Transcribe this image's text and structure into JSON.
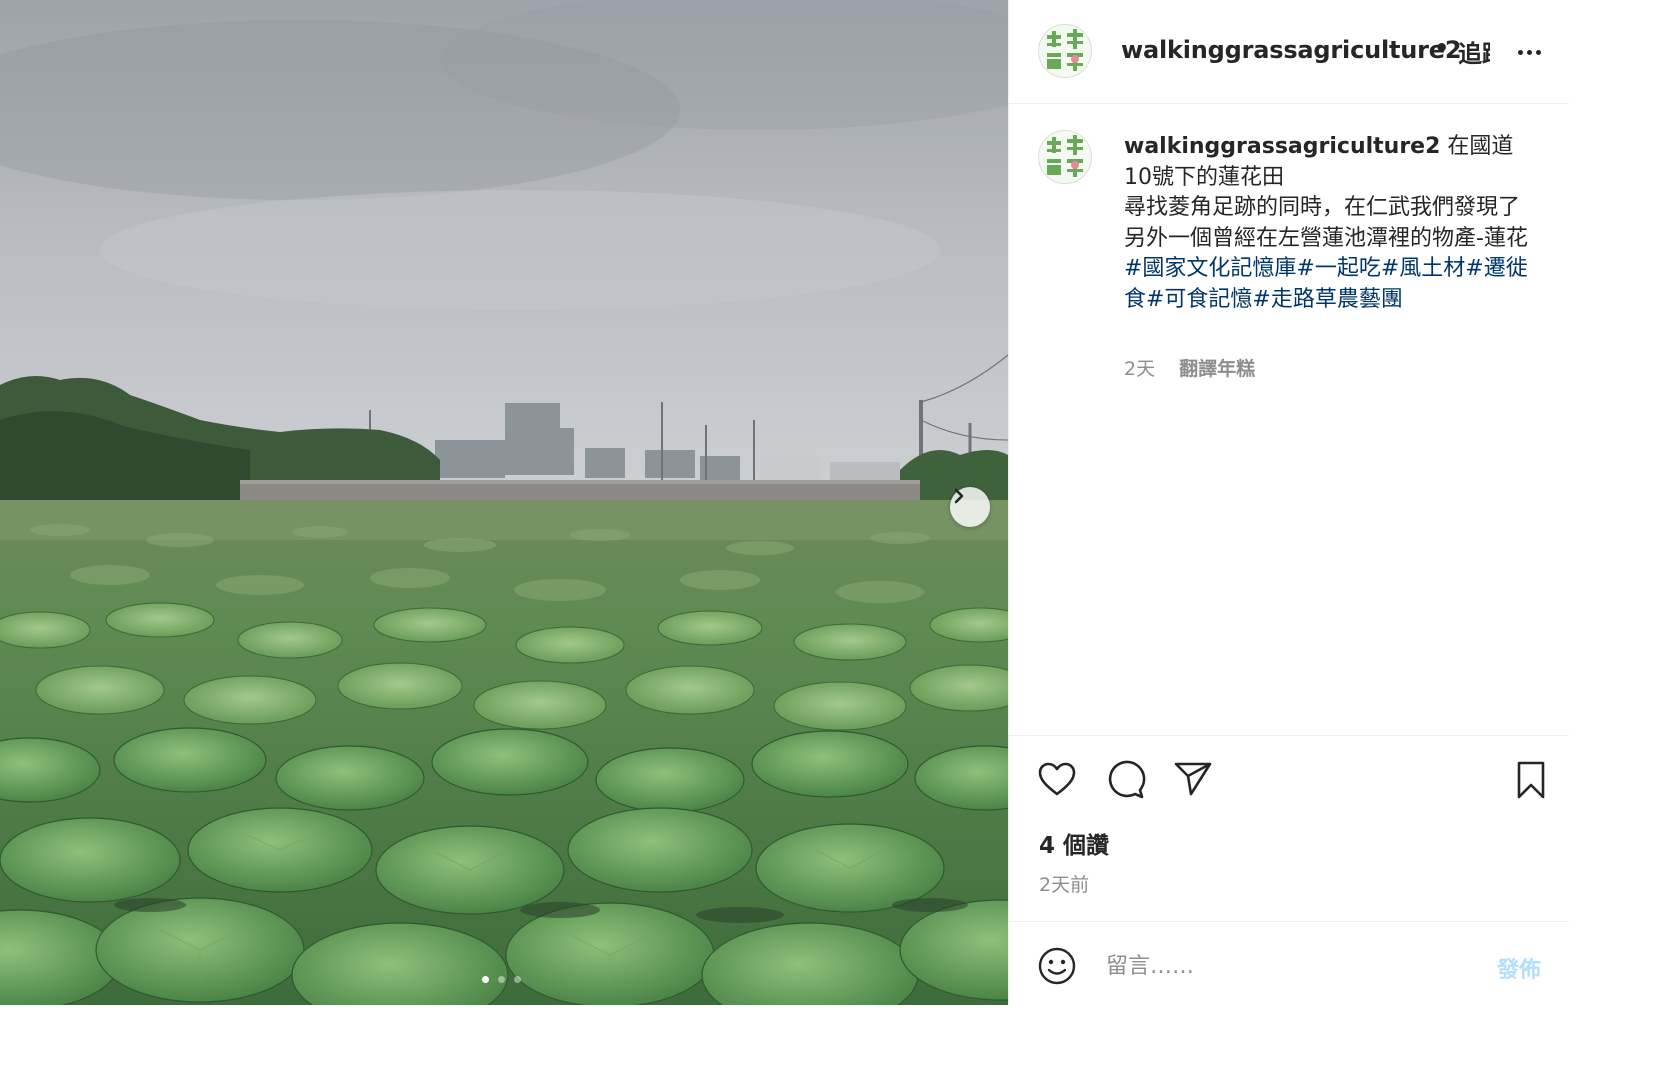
{
  "post": {
    "username": "walkinggrassagriculture2",
    "separator": "•",
    "follow_label": "追蹤",
    "more_icon": "more-horizontal-icon",
    "caption": {
      "username": "walkinggrassagriculture2",
      "lines": [
        "在國道10號下的蓮花田",
        "尋找菱角足跡的同時，在仁武我們發現了另外一個曾經在左營蓮池潭裡的物產-蓮花"
      ],
      "hashtags": "#國家文化記憶庫#一起吃#風土材#遷徙食#可食記憶#走路草農藝團"
    },
    "time_ago": "2天",
    "translate_label": "翻譯年糕",
    "likes_label": "4 個讚",
    "date_label": "2天前",
    "comment_placeholder": "留言……",
    "post_button_label": "發佈",
    "carousel": {
      "slide_count": 3,
      "active_index": 0,
      "next_icon": "chevron-right-icon"
    },
    "icons": {
      "like": "heart-icon",
      "comment": "comment-icon",
      "share": "paper-plane-icon",
      "save": "bookmark-icon",
      "emoji": "smiley-icon"
    },
    "colors": {
      "hashtag": "#00376b",
      "post_button_disabled": "#b2dffc",
      "secondary_text": "#8e8e8e"
    }
  }
}
